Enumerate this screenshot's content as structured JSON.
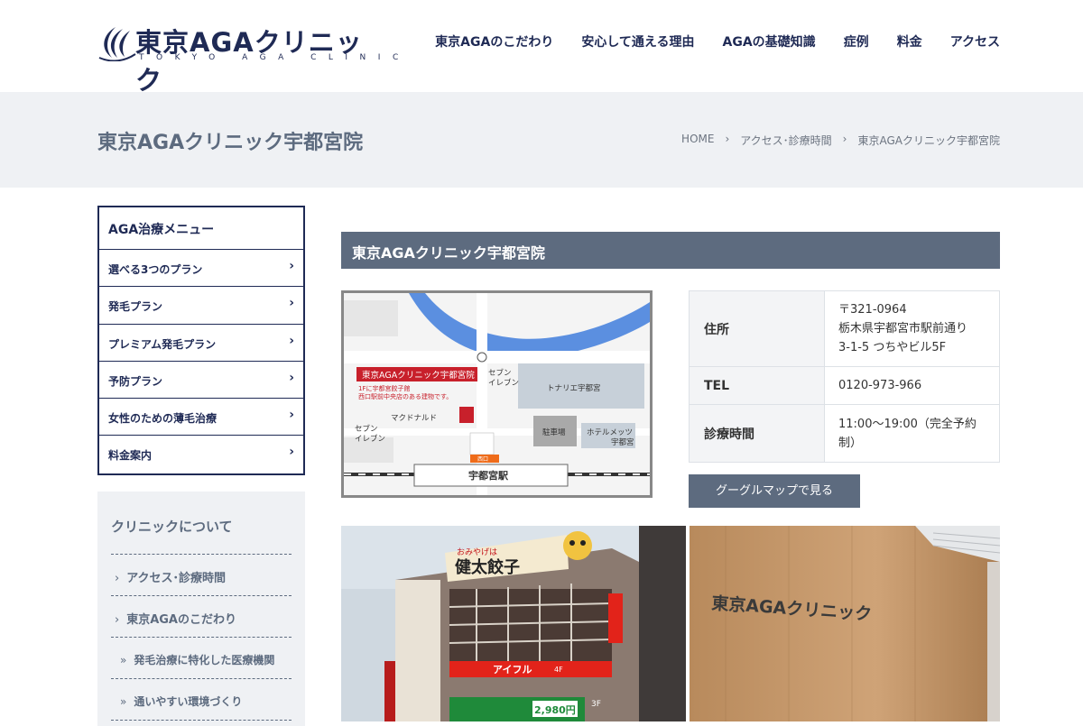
{
  "header": {
    "logo_text": "東京AGAクリニック",
    "logo_sub": "TOKYO AGA CLINIC",
    "nav": [
      "東京AGAのこだわり",
      "安心して通える理由",
      "AGAの基礎知識",
      "症例",
      "料金",
      "アクセス"
    ]
  },
  "title_band": {
    "title": "東京AGAクリニック宇都宮院",
    "breadcrumb": [
      "HOME",
      "アクセス･診療時間",
      "東京AGAクリニック宇都宮院"
    ]
  },
  "side_menu": {
    "title": "AGA治療メニュー",
    "items": [
      "選べる3つのプラン",
      "発毛プラン",
      "プレミアム発毛プラン",
      "予防プラン",
      "女性のための薄毛治療",
      "料金案内"
    ]
  },
  "side_about": {
    "title": "クリニックについて",
    "items": [
      "アクセス･診療時間",
      "東京AGAのこだわり"
    ],
    "sub_items": [
      "発毛治療に特化した医療機関",
      "通いやすい環境づくり"
    ]
  },
  "main": {
    "section_title": "東京AGAクリニック宇都宮院",
    "map": {
      "clinic_label": "東京AGAクリニック宇都宮院",
      "note_line1": "1Fに宇都宮餃子館",
      "note_line2": "西口駅前中央店のある建物です。",
      "seven_top_1": "セブン",
      "seven_top_2": "イレブン",
      "tonarie": "トナリエ宇都宮",
      "mcdonalds": "マクドナルド",
      "seven_left_1": "セブン",
      "seven_left_2": "イレブン",
      "parking": "駐車場",
      "hotel_1": "ホテルメッツ",
      "hotel_2": "宇都宮",
      "west_exit": "西口",
      "station": "宇都宮駅"
    },
    "info": {
      "address_label": "住所",
      "address_line1": "〒321-0964",
      "address_line2": "栃木県宇都宮市駅前通り",
      "address_line3": "3-1-5 つちやビル5F",
      "tel_label": "TEL",
      "tel": "0120-973-966",
      "hours_label": "診療時間",
      "hours_line1": "11:00〜19:00（完全予約",
      "hours_line2": "制）"
    },
    "map_button": "グーグルマップで見る",
    "photo_left": {
      "sign_top": "おみやげは",
      "sign_main": "健太餃子",
      "aiful": "アイフル",
      "aiful_floor": "4F",
      "price": "2,980円",
      "floor3": "3F"
    },
    "photo_right": {
      "wall_text": "東京AGAクリニック"
    }
  },
  "colors": {
    "navy": "#1f2a55",
    "slate": "#5d6b7f",
    "band": "#eff1f4",
    "clinic_red": "#c8202b"
  }
}
